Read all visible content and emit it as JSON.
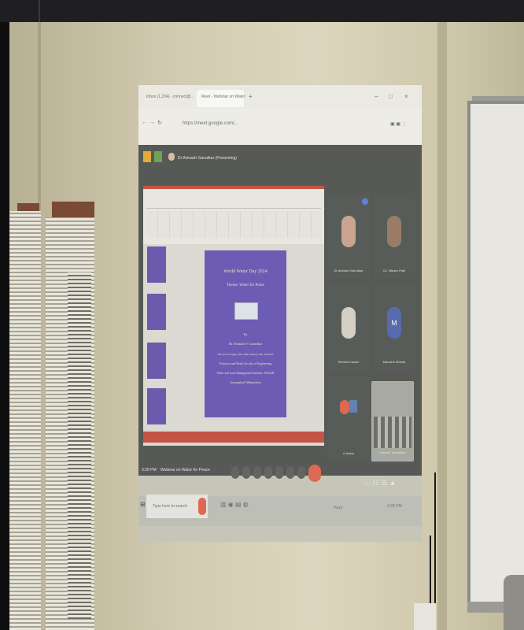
{
  "browser": {
    "tab1": "Inbox (1,234) - connect@...",
    "tab2": "Meet - Webinar on Water",
    "address": "https://meet.google.com/..."
  },
  "meet": {
    "presenting_label": "Dr Avinash Garudkar (Presenting)",
    "meeting_title": "Webinar on Water for Peace",
    "time": "3:35 PM",
    "participants": [
      {
        "name": "Dr Avinash Garudkar"
      },
      {
        "name": "Dr. Vikram Patil"
      },
      {
        "name": "Sheetal Kasule"
      },
      {
        "name": "Manisha Shinde",
        "initial": "M"
      },
      {
        "name": "4 others"
      },
      {
        "name": "Vaishali Tambolkar"
      }
    ]
  },
  "slide": {
    "line1": "World Water Day 2024",
    "line2": "Theme: Water for Peace",
    "by": "By",
    "author": "Dr Avinash V Garudkar",
    "degrees": "ME (Civil Engg), PhD, MIE (India), FIE, MIWRS",
    "position1": "Professor and Head, Faculty of Engineering",
    "position2": "Water and Land Management Institute, WALMI",
    "city": "Aurangabad, Maharashtra"
  },
  "taskbar": {
    "search_placeholder": "Type here to search",
    "weather": "Haze",
    "clock": "3:35 PM"
  },
  "colors": {
    "slide_bg": "#5743b0",
    "ppt_red": "#c0392b",
    "end_call": "#e0523c"
  }
}
